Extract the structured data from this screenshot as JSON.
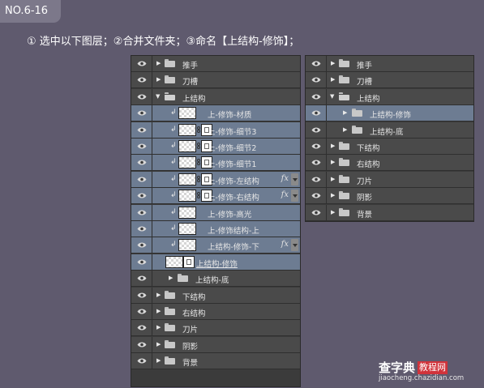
{
  "badge": "NO.6-16",
  "instruction": "① 选中以下图层；②合并文件夹；③命名【上结构-修饰】；",
  "left_panel": {
    "rows": [
      {
        "label": "推手",
        "type": "group"
      },
      {
        "label": "刀槽",
        "type": "group"
      },
      {
        "label": "上结构",
        "type": "group-open"
      },
      {
        "label": "上-修饰-材质",
        "type": "layer",
        "selected": true,
        "clipped": true,
        "mask": false,
        "fx": false
      },
      {
        "label": "上-修饰-细节3",
        "type": "layer",
        "selected": true,
        "clipped": true,
        "mask": true,
        "fx": false
      },
      {
        "label": "上-修饰-细节2",
        "type": "layer",
        "selected": true,
        "clipped": true,
        "mask": true,
        "fx": false
      },
      {
        "label": "上-修饰-细节1",
        "type": "layer",
        "selected": true,
        "clipped": true,
        "mask": true,
        "fx": false
      },
      {
        "label": "上-修饰-左结构",
        "type": "layer",
        "selected": true,
        "clipped": true,
        "mask": true,
        "fx": true
      },
      {
        "label": "上-修饰-右结构",
        "type": "layer",
        "selected": true,
        "clipped": true,
        "mask": true,
        "fx": true
      },
      {
        "label": "上-修饰-高光",
        "type": "layer",
        "selected": true,
        "clipped": true,
        "mask": false,
        "fx": false
      },
      {
        "label": "上-修饰结构-上",
        "type": "layer",
        "selected": true,
        "clipped": true,
        "mask": false,
        "fx": false
      },
      {
        "label": "上结构-修饰-下",
        "type": "layer",
        "selected": true,
        "clipped": true,
        "mask": false,
        "fx": true
      },
      {
        "label": "上结构-修饰",
        "type": "base",
        "selected": true
      },
      {
        "label": "上结构-底",
        "type": "subgroup"
      },
      {
        "label": "下结构",
        "type": "group"
      },
      {
        "label": "右结构",
        "type": "group"
      },
      {
        "label": "刀片",
        "type": "group"
      },
      {
        "label": "阴影",
        "type": "group"
      },
      {
        "label": "背景",
        "type": "group"
      }
    ],
    "fx_label": "fx"
  },
  "right_panel": {
    "rows": [
      {
        "label": "推手",
        "type": "group"
      },
      {
        "label": "刀槽",
        "type": "group"
      },
      {
        "label": "上结构",
        "type": "group-open"
      },
      {
        "label": "上结构-修饰",
        "type": "subgroup",
        "selected": true
      },
      {
        "label": "上结构-底",
        "type": "subgroup"
      },
      {
        "label": "下结构",
        "type": "group"
      },
      {
        "label": "右结构",
        "type": "group"
      },
      {
        "label": "刀片",
        "type": "group"
      },
      {
        "label": "阴影",
        "type": "group"
      },
      {
        "label": "背景",
        "type": "group"
      }
    ]
  },
  "watermark": {
    "brand": "查字典",
    "box": "教程网",
    "url": "jiaocheng.chazidian.com"
  },
  "colors": {
    "background": "#5f5a6e",
    "panel_row": "#4a4a4a",
    "selected_row": "#6d7c92"
  }
}
